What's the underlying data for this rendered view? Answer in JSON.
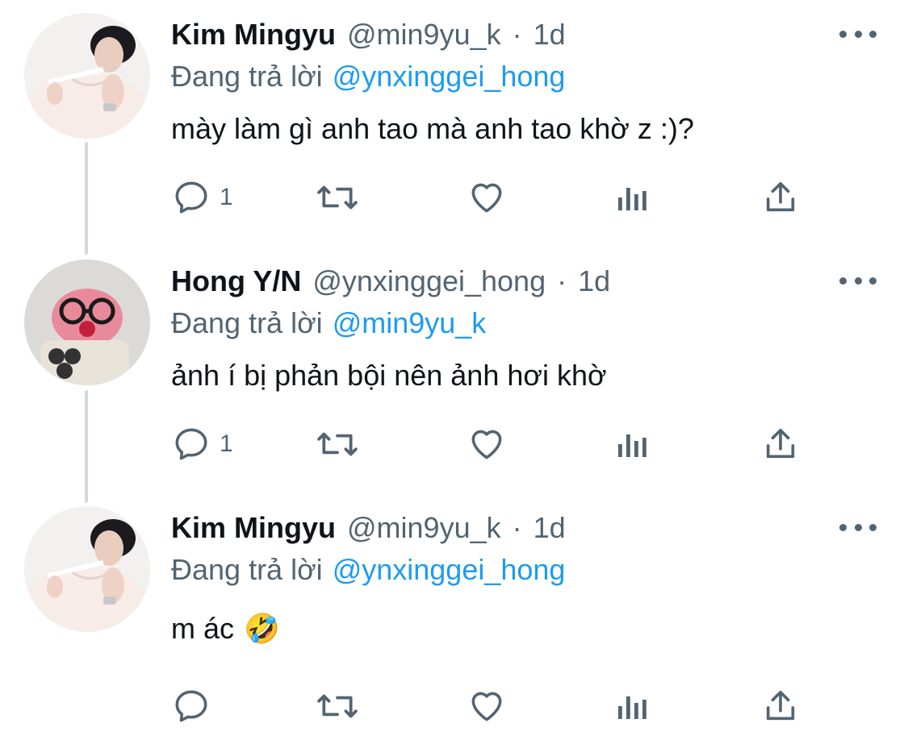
{
  "thread": [
    {
      "name": "Kim Mingyu",
      "handle": "@min9yu_k",
      "separator": "·",
      "time": "1d",
      "reply_prefix": "Đang trả lời",
      "reply_to": "@ynxinggei_hong",
      "text": "mày làm gì anh tao mà anh tao khờ z :)?",
      "emoji": "",
      "reply_count": "1",
      "avatar": "kim-mingyu-avatar"
    },
    {
      "name": "Hong Y/N",
      "handle": "@ynxinggei_hong",
      "separator": "·",
      "time": "1d",
      "reply_prefix": "Đang trả lời",
      "reply_to": "@min9yu_k",
      "text": "ảnh í bị phản bội nên ảnh hơi khờ",
      "emoji": "",
      "reply_count": "1",
      "avatar": "hong-yn-avatar"
    },
    {
      "name": "Kim Mingyu",
      "handle": "@min9yu_k",
      "separator": "·",
      "time": "1d",
      "reply_prefix": "Đang trả lời",
      "reply_to": "@ynxinggei_hong",
      "text": "m ác",
      "emoji": "🤣",
      "reply_count": "",
      "avatar": "kim-mingyu-avatar"
    }
  ],
  "icons": {
    "reply": "reply-icon",
    "retweet": "retweet-icon",
    "like": "heart-icon",
    "views": "views-icon",
    "share": "share-icon",
    "more": "more-icon"
  },
  "colors": {
    "text": "#0f1419",
    "secondary": "#536471",
    "link": "#1d9bf0",
    "thread_line": "#cfd9de"
  }
}
